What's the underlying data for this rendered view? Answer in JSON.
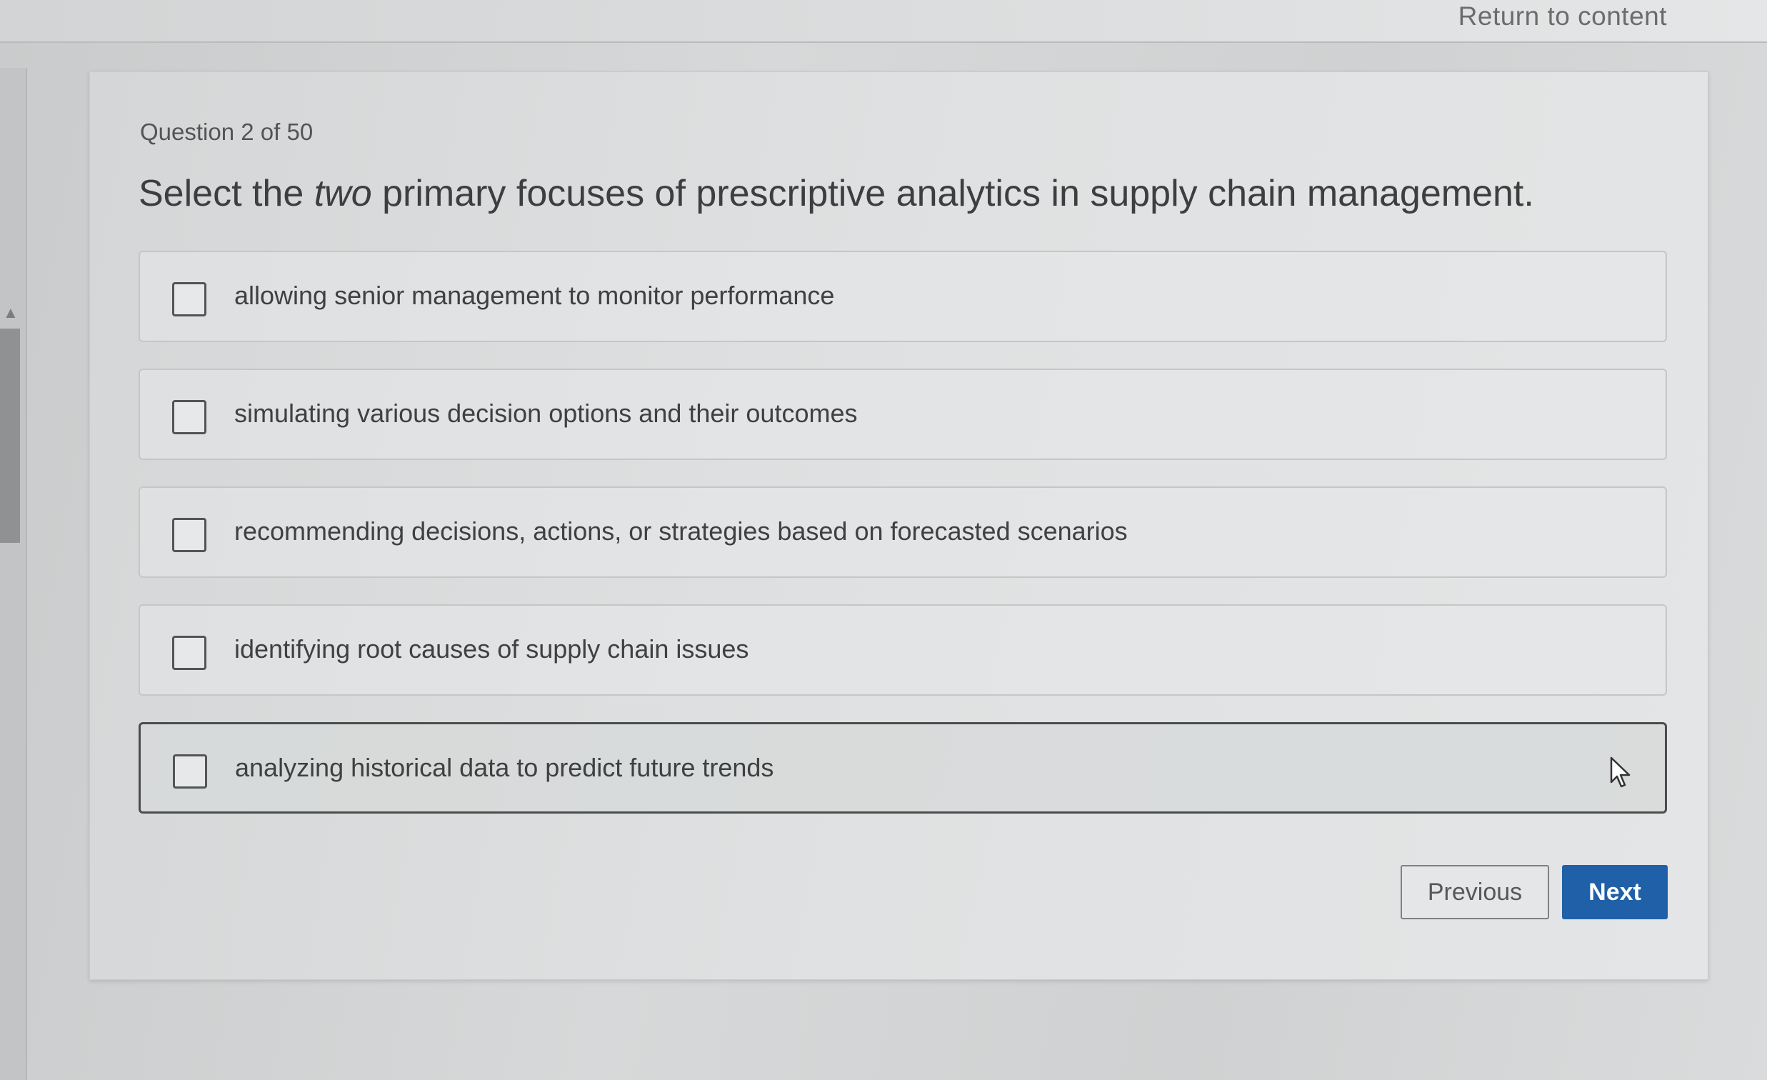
{
  "header": {
    "return_label": "Return to content"
  },
  "question": {
    "counter": "Question 2 of 50",
    "text_before": "Select the ",
    "text_emphasis": "two",
    "text_after": " primary focuses of prescriptive analytics in supply chain management."
  },
  "options": [
    {
      "label": "allowing senior management to monitor performance",
      "checked": false
    },
    {
      "label": "simulating various decision options and their outcomes",
      "checked": false
    },
    {
      "label": "recommending decisions, actions, or strategies based on forecasted scenarios",
      "checked": false
    },
    {
      "label": "identifying root causes of supply chain issues",
      "checked": false
    },
    {
      "label": "analyzing historical data to predict future trends",
      "checked": false
    }
  ],
  "navigation": {
    "previous_label": "Previous",
    "next_label": "Next"
  },
  "colors": {
    "next_button": "#2060a8"
  }
}
